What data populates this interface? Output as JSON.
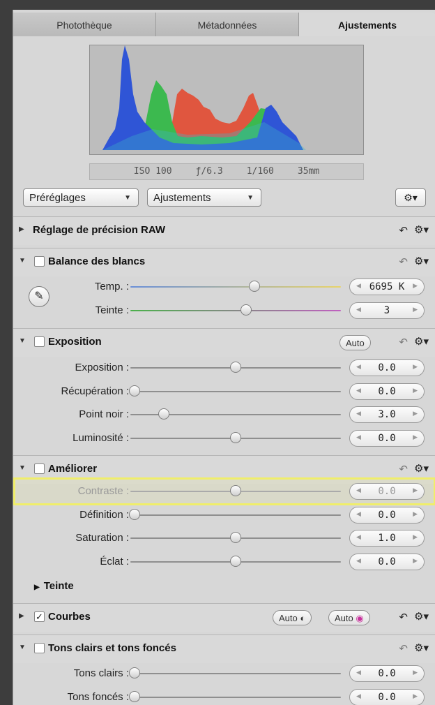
{
  "tabs": [
    {
      "label": "Photothèque"
    },
    {
      "label": "Métadonnées"
    },
    {
      "label": "Ajustements"
    }
  ],
  "exif": {
    "iso": "ISO 100",
    "aperture": "ƒ/6.3",
    "shutter": "1/160",
    "focal": "35mm"
  },
  "toolbar": {
    "presets_label": "Préréglages",
    "adjustments_label": "Ajustements",
    "gear_icon": "gear-icon"
  },
  "sections": {
    "raw": {
      "title": "Réglage de précision RAW"
    },
    "wb": {
      "title": "Balance des blancs",
      "temp": {
        "label": "Temp. :",
        "value": "6695 K",
        "level": 0.59
      },
      "tint": {
        "label": "Teinte :",
        "value": "3",
        "level": 0.55
      }
    },
    "exposure": {
      "title": "Exposition",
      "auto_label": "Auto",
      "rows": [
        {
          "label": "Exposition :",
          "value": "0.0",
          "level": 0.5
        },
        {
          "label": "Récupération :",
          "value": "0.0",
          "level": 0.02
        },
        {
          "label": "Point noir :",
          "value": "3.0",
          "level": 0.16
        },
        {
          "label": "Luminosité :",
          "value": "0.0",
          "level": 0.5
        }
      ]
    },
    "enhance": {
      "title": "Améliorer",
      "rows": [
        {
          "label": "Contraste :",
          "value": "0.0",
          "level": 0.5
        },
        {
          "label": "Définition :",
          "value": "0.0",
          "level": 0.02
        },
        {
          "label": "Saturation :",
          "value": "1.0",
          "level": 0.5
        },
        {
          "label": "Éclat :",
          "value": "0.0",
          "level": 0.5
        }
      ],
      "sub_title": "Teinte"
    },
    "curves": {
      "title": "Courbes",
      "auto1": "Auto",
      "auto2": "Auto"
    },
    "shadows": {
      "title": "Tons clairs et tons foncés",
      "rows": [
        {
          "label": "Tons clairs :",
          "value": "0.0",
          "level": 0.02
        },
        {
          "label": "Tons foncés :",
          "value": "0.0",
          "level": 0.02
        }
      ]
    }
  }
}
